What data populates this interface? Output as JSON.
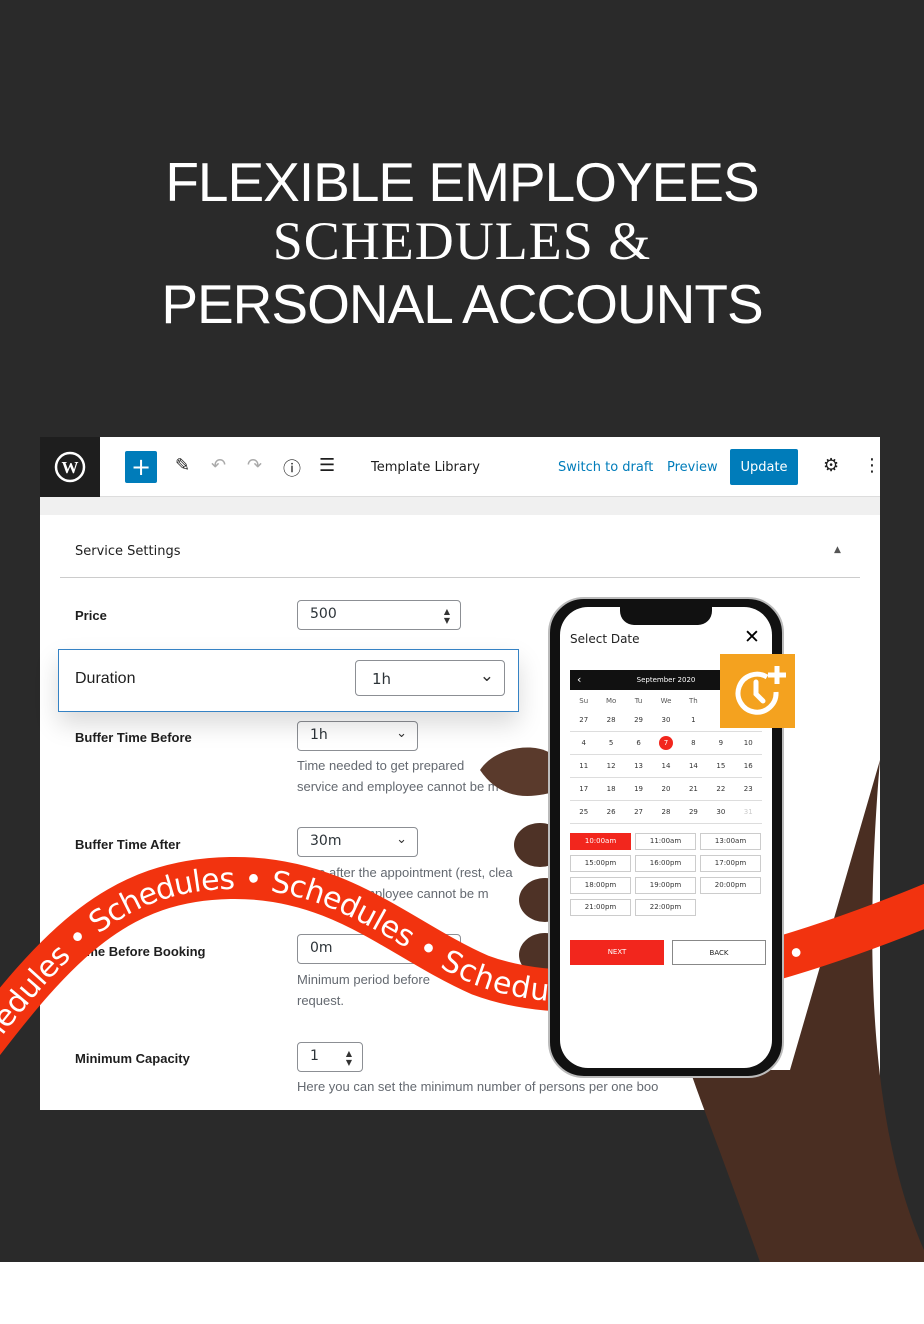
{
  "hero": {
    "line1": "FLEXIBLE EMPLOYEES",
    "line2": "SCHEDULES &",
    "line3": "PERSONAL ACCOUNTS"
  },
  "toolbar": {
    "add": "+",
    "template_library": "Template Library",
    "switch_to_draft": "Switch to draft",
    "preview": "Preview",
    "update": "Update"
  },
  "settings": {
    "section_title": "Service Settings",
    "price": {
      "label": "Price",
      "value": "500"
    },
    "duration": {
      "label": "Duration",
      "value": "1h"
    },
    "buffer_before": {
      "label": "Buffer Time Before",
      "value": "1h",
      "help1": "Time needed to get prepared",
      "help2": "service and employee cannot be m"
    },
    "buffer_after": {
      "label": "Buffer Time After",
      "value": "30m",
      "help1": "Time after the appointment (rest, clea",
      "help2": "employee cannot be m"
    },
    "min_before": {
      "label": "Time Before Booking",
      "value": "0m",
      "help1": "Minimum period before",
      "help2": "request."
    },
    "min_capacity": {
      "label": "Minimum Capacity",
      "value": "1",
      "help1": "Here you can set the minimum number of persons per one boo"
    }
  },
  "phone": {
    "title": "Select Date",
    "close": "✕",
    "month": "September 2020",
    "prev": "‹",
    "weekdays": [
      "Su",
      "Mo",
      "Tu",
      "We",
      "Th",
      "",
      ""
    ],
    "weeks": [
      [
        "27",
        "28",
        "29",
        "30",
        "1",
        "",
        ""
      ],
      [
        "4",
        "5",
        "6",
        "7",
        "8",
        "9",
        "10"
      ],
      [
        "11",
        "12",
        "13",
        "14",
        "14",
        "15",
        "16"
      ],
      [
        "17",
        "18",
        "19",
        "20",
        "21",
        "22",
        "23"
      ],
      [
        "25",
        "26",
        "27",
        "28",
        "29",
        "30",
        "31"
      ]
    ],
    "selected_day": "7",
    "slots": [
      "10:00am",
      "11:00am",
      "13:00am",
      "15:00pm",
      "16:00pm",
      "17:00pm",
      "18:00pm",
      "19:00pm",
      "20:00pm",
      "21:00pm",
      "22:00pm"
    ],
    "selected_slot": "10:00am",
    "next": "NEXT",
    "back": "BACK"
  },
  "ribbon": {
    "text": "Schedules • Schedules • Schedules • Schedules • Schedules •"
  },
  "colors": {
    "accent": "#007cba",
    "ribbon": "#f2330f",
    "orange": "#f4a21f",
    "selected": "#f2261d"
  }
}
